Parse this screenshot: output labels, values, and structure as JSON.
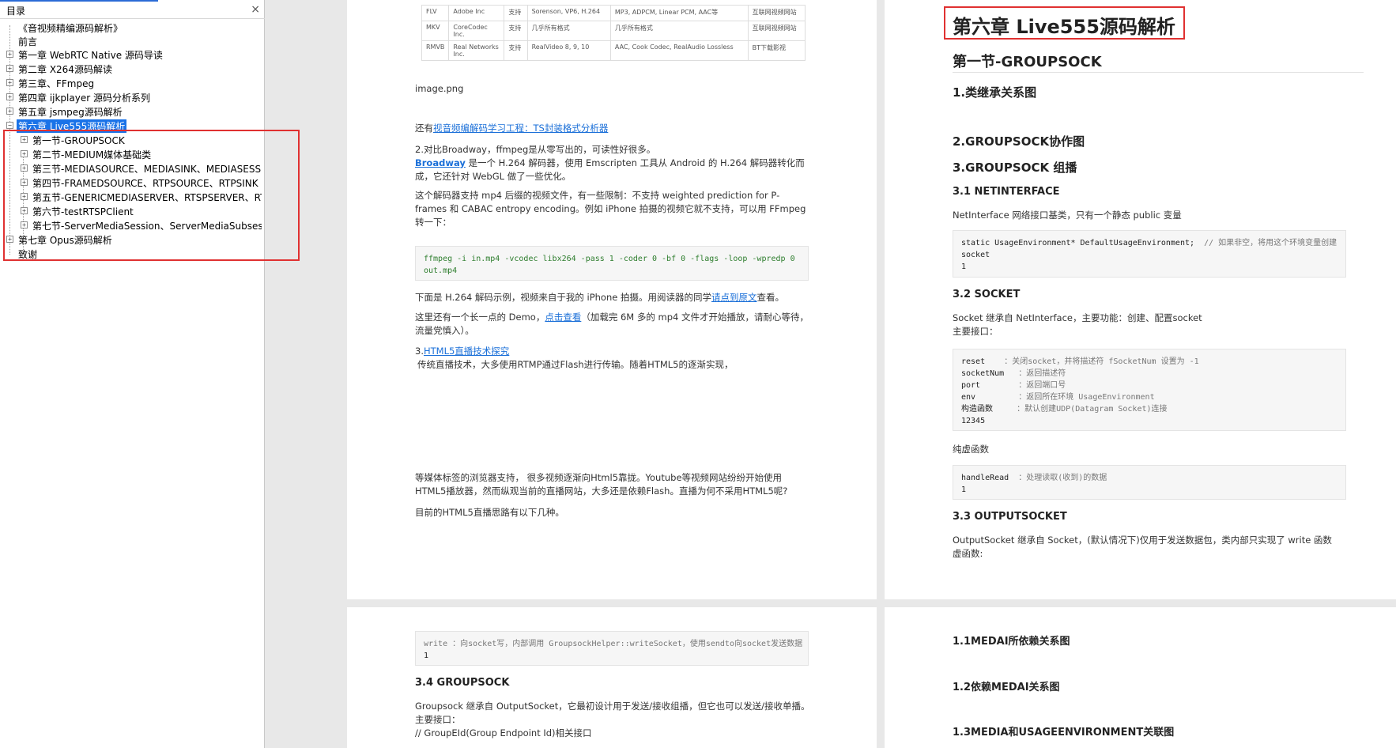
{
  "sidebar": {
    "title": "目录",
    "close_glyph": "×",
    "items": [
      {
        "label": "《音视频精编源码解析》",
        "expander": ""
      },
      {
        "label": "前言",
        "expander": ""
      },
      {
        "label": "第一章 WebRTC Native 源码导读",
        "expander": "+"
      },
      {
        "label": "第二章 X264源码解读",
        "expander": "+"
      },
      {
        "label": "第三章、FFmpeg",
        "expander": "+"
      },
      {
        "label": "第四章 ijkplayer 源码分析系列",
        "expander": "+"
      },
      {
        "label": "第五章 jsmpeg源码解析",
        "expander": "+"
      },
      {
        "label": "第六章 Live555源码解析",
        "expander": "−"
      },
      {
        "label": "第一节-GROUPSOCK",
        "expander": "+"
      },
      {
        "label": "第二节-MEDIUM媒体基础类",
        "expander": "+"
      },
      {
        "label": "第三节-MEDIASOURCE、MEDIASINK、MEDIASESS",
        "expander": "+"
      },
      {
        "label": "第四节-FRAMEDSOURCE、RTPSOURCE、RTPSINK",
        "expander": "+"
      },
      {
        "label": "第五节-GENERICMEDIASERVER、RTSPSERVER、RT",
        "expander": "+"
      },
      {
        "label": "第六节-testRTSPClient",
        "expander": "+"
      },
      {
        "label": "第七节-ServerMediaSession、ServerMediaSubsess",
        "expander": "+"
      },
      {
        "label": "第七章 Opus源码解析",
        "expander": "+"
      },
      {
        "label": "致谢",
        "expander": ""
      }
    ]
  },
  "page1": {
    "table": [
      [
        "FLV",
        "Adobe Inc",
        "支持",
        "Sorenson, VP6, H.264",
        "MP3, ADPCM, Linear PCM, AAC等",
        "互联网视频网站"
      ],
      [
        "MKV",
        "CoreCodec Inc.",
        "支持",
        "几乎所有格式",
        "几乎所有格式",
        "互联网视频网站"
      ],
      [
        "RMVB",
        "Real Networks Inc.",
        "支持",
        "RealVideo 8, 9, 10",
        "AAC, Cook Codec, RealAudio Lossless",
        "BT下载影视"
      ]
    ],
    "image_caption": "image.png",
    "also_prefix": "还有",
    "also_link": "视音频编解码学习工程：TS封装格式分析器",
    "p2_line1": "2.对比Broadway，ffmpeg是从零写出的，可读性好很多。",
    "p2_link": "Broadway",
    "p2_rest": " 是一个 H.264 解码器，使用 Emscripten 工具从 Android 的 H.264 解码器转化而成，它还针对 WebGL 做了一些优化。",
    "p3": "这个解码器支持 mp4 后缀的视频文件，有一些限制：不支持 weighted prediction for P-frames 和 CABAC entropy encoding。例如 iPhone 拍摄的视频它就不支持，可以用 FFmpeg 转一下：",
    "code1": "ffmpeg -i in.mp4 -vcodec libx264 -pass 1 -coder 0 -bf 0 -flags -loop -wpredp 0\nout.mp4",
    "p4_prefix": "下面是 H.264 解码示例，视频来自于我的 iPhone 拍摄。用阅读器的同学",
    "p4_link": "请点到原文",
    "p4_suffix": "查看。",
    "p5_prefix": "这里还有一个长一点的 Demo，",
    "p5_link": "点击查看",
    "p5_suffix": "（加载完 6M 多的 mp4 文件才开始播放，请耐心等待，流量党慎入）。",
    "p6_prefix": "3.",
    "p6_link": "HTML5直播技术探究",
    "p6_rest": "传统直播技术，大多使用RTMP通过Flash进行传输。随着HTML5的逐渐实现，",
    "p7": "等媒体标签的浏览器支持， 很多视频逐渐向Html5靠拢。Youtube等视频网站纷纷开始使用HTML5播放器，然而纵观当前的直播网站，大多还是依赖Flash。直播为何不采用HTML5呢?",
    "p8": "目前的HTML5直播思路有以下几种。"
  },
  "page2": {
    "chapter_title": "第六章 Live555源码解析",
    "section_title": "第一节-GROUPSOCK",
    "h_class_tree": "1.类继承关系图",
    "h_collab": "2.GROUPSOCK协作图",
    "h_compose": "3.GROUPSOCK 组播",
    "h_netif": "3.1 NETINTERFACE",
    "netif_desc": "NetInterface 网络接口基类，只有一个静态 public 变量",
    "code_netif_l1": "static UsageEnvironment* DefaultUsageEnvironment;",
    "code_netif_cm": "// 如果非空，将用这个环境变量创建",
    "code_netif_l2": "socket",
    "code_netif_l3": "1",
    "h_socket": "3.2 SOCKET",
    "socket_desc1": "Socket 继承自 NetInterface，主要功能：创建、配置socket",
    "socket_desc2": "主要接口：",
    "socket_code": [
      {
        "k": "reset",
        "d": "：关闭socket，并将描述符 fSocketNum 设置为 -1"
      },
      {
        "k": "socketNum",
        "d": "：返回描述符"
      },
      {
        "k": "port",
        "d": "：返回端口号"
      },
      {
        "k": "env",
        "d": "：返回所在环境 UsageEnvironment"
      },
      {
        "k": "构造函数",
        "d": "：默认创建UDP(Datagram Socket)连接"
      }
    ],
    "socket_code_tail": "12345",
    "pure_fn": "纯虚函数",
    "code_hr_k": "handleRead",
    "code_hr_d": "：处理读取(收到)的数据",
    "code_hr_n": "1",
    "h_outsock": "3.3 OUTPUTSOCKET",
    "out_desc1": "OutputSocket 继承自 Socket，(默认情况下)仅用于发送数据包，类内部只实现了 write 函数",
    "out_desc2": "虚函数:"
  },
  "page3": {
    "code_write": "write ：向socket写，内部调用 GroupsockHelper::writeSocket，使用sendto向socket发送数据",
    "code_write_n": "1",
    "h_groupsock": "3.4 GROUPSOCK",
    "gs_desc1": "Groupsock 继承自 OutputSocket，它最初设计用于发送/接收组播，但它也可以发送/接收单播。",
    "gs_desc2": "主要接口：",
    "gs_desc3": "// GroupEId(Group Endpoint Id)相关接口"
  },
  "page4": {
    "h1": "1.1MEDAI所依赖关系图",
    "h2": "1.2依赖MEDAI关系图",
    "h3": "1.3MEDIA和USAGEENVIRONMENT关联图"
  }
}
